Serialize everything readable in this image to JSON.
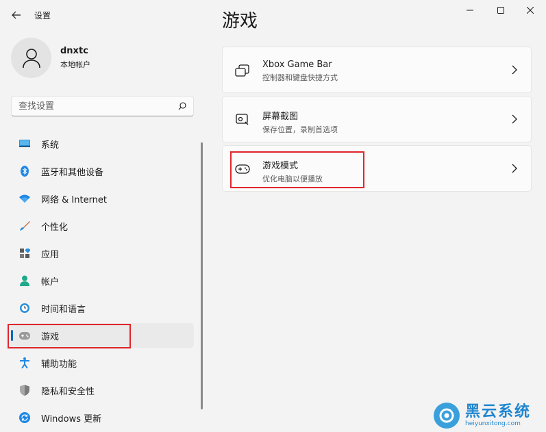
{
  "app": {
    "title": "设置"
  },
  "window_controls": {
    "minimize": "minimize-icon",
    "maximize": "maximize-icon",
    "close": "close-icon"
  },
  "profile": {
    "name": "dnxtc",
    "account_type": "本地帐户"
  },
  "search": {
    "placeholder": "查找设置"
  },
  "sidebar": {
    "items": [
      {
        "label": "系统",
        "icon": "monitor-icon"
      },
      {
        "label": "蓝牙和其他设备",
        "icon": "bluetooth-icon"
      },
      {
        "label": "网络 & Internet",
        "icon": "wifi-icon"
      },
      {
        "label": "个性化",
        "icon": "brush-icon"
      },
      {
        "label": "应用",
        "icon": "apps-icon"
      },
      {
        "label": "帐户",
        "icon": "person-icon"
      },
      {
        "label": "时间和语言",
        "icon": "clock-globe-icon"
      },
      {
        "label": "游戏",
        "icon": "gamepad-icon",
        "active": true
      },
      {
        "label": "辅助功能",
        "icon": "accessibility-icon"
      },
      {
        "label": "隐私和安全性",
        "icon": "shield-icon"
      },
      {
        "label": "Windows 更新",
        "icon": "update-icon"
      }
    ]
  },
  "main": {
    "title": "游戏",
    "cards": [
      {
        "title": "Xbox Game Bar",
        "subtitle": "控制器和键盘快捷方式",
        "icon": "game-bar-icon"
      },
      {
        "title": "屏幕截图",
        "subtitle": "保存位置，录制首选项",
        "icon": "capture-icon"
      },
      {
        "title": "游戏模式",
        "subtitle": "优化电脑以便播放",
        "icon": "gamepad-icon"
      }
    ]
  },
  "watermark": {
    "name": "黑云系统",
    "url": "heiyunxitong.com"
  },
  "colors": {
    "accent": "#0067c0",
    "highlight": "#e0252b",
    "watermark": "#1f86d0"
  }
}
